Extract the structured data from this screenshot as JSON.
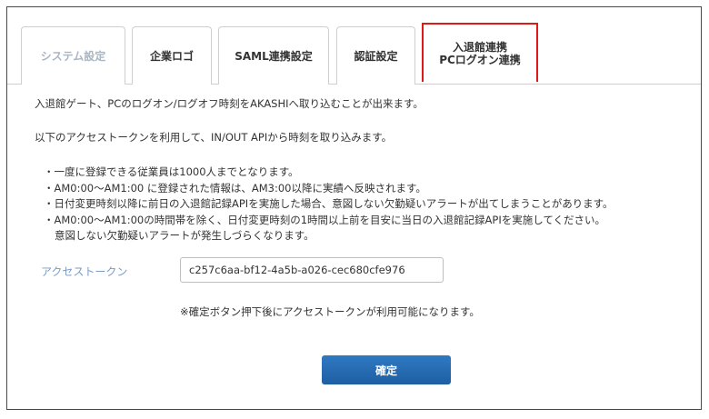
{
  "tabs": [
    {
      "label": "システム設定",
      "state": "disabled"
    },
    {
      "label": "企業ロゴ",
      "state": "normal"
    },
    {
      "label": "SAML連携設定",
      "state": "normal"
    },
    {
      "label": "認証設定",
      "state": "normal"
    },
    {
      "label_line1": "入退館連携",
      "label_line2": "PCログオン連携",
      "state": "active"
    }
  ],
  "content": {
    "intro1": "入退館ゲート、PCのログオン/ログオフ時刻をAKASHIへ取り込むことが出来ます。",
    "intro2": "以下のアクセストークンを利用して、IN/OUT APIから時刻を取り込みます。",
    "notes": [
      "・一度に登録できる従業員は1000人までとなります。",
      "・AM0:00～AM1:00 に登録された情報は、AM3:00以降に実績へ反映されます。",
      "・日付変更時刻以降に前日の入退館記録APIを実施した場合、意図しない欠勤疑いアラートが出てしまうことがあります。",
      "・AM0:00～AM1:00の時間帯を除く、日付変更時刻の1時間以上前を目安に当日の入退館記録APIを実施してください。",
      "意図しない欠勤疑いアラートが発生しづらくなります。"
    ],
    "token_label": "アクセストークン",
    "token_value": "c257c6aa-bf12-4a5b-a026-cec680cfe976",
    "hint": "※確定ボタン押下後にアクセストークンが利用可能になります。",
    "confirm_label": "確定"
  },
  "colors": {
    "active_tab_border": "#e01818",
    "button_bg": "#1e5fa3",
    "label_text": "#7a9bc4",
    "disabled_tab_text": "#a9b6c4"
  }
}
